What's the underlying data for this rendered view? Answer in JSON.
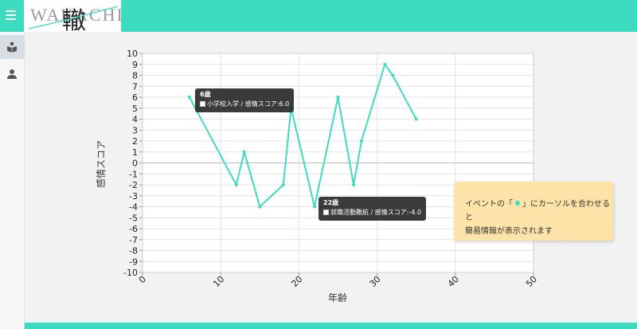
{
  "app": {
    "logo_text_latin": "WAKACHI",
    "logo_text_kanji": "轍"
  },
  "sidebar": {
    "items": [
      {
        "icon": "book-reader-icon",
        "active": true
      },
      {
        "icon": "person-icon",
        "active": false
      }
    ]
  },
  "colors": {
    "accent": "#3ddbbf",
    "note_bg": "#fde3a7",
    "tooltip_bg": "#262626"
  },
  "chart_data": {
    "type": "line",
    "xlabel": "年齢",
    "ylabel": "感情スコア",
    "xlim": [
      0,
      50
    ],
    "ylim": [
      -10,
      10
    ],
    "x_ticks": [
      0,
      10,
      20,
      30,
      40,
      50
    ],
    "y_ticks": [
      10,
      9,
      8,
      7,
      6,
      5,
      4,
      3,
      2,
      1,
      0,
      -1,
      -2,
      -3,
      -4,
      -5,
      -6,
      -7,
      -8,
      -9,
      -10
    ],
    "grid": true,
    "legend": "none",
    "series": [
      {
        "points": [
          {
            "x": 6,
            "y": 6
          },
          {
            "x": 12,
            "y": -2
          },
          {
            "x": 13,
            "y": 1
          },
          {
            "x": 15,
            "y": -4
          },
          {
            "x": 18,
            "y": -2
          },
          {
            "x": 19,
            "y": 5
          },
          {
            "x": 22,
            "y": -4
          },
          {
            "x": 25,
            "y": 6
          },
          {
            "x": 27,
            "y": -2
          },
          {
            "x": 28,
            "y": 2
          },
          {
            "x": 31,
            "y": 9
          },
          {
            "x": 32,
            "y": 8
          },
          {
            "x": 35,
            "y": 4
          }
        ]
      }
    ],
    "tooltips": [
      {
        "x": 6,
        "y": 6,
        "title": "6歳",
        "body": "小学校入学 / 感情スコア:6.0"
      },
      {
        "x": 22,
        "y": -4,
        "title": "22歳",
        "body": "就職活動難航 / 感情スコア:-4.0"
      }
    ]
  },
  "note": {
    "text_before": "イベントの「",
    "text_after": "」にカーソルを合わせると",
    "line2": "簡易情報が表示されます"
  }
}
